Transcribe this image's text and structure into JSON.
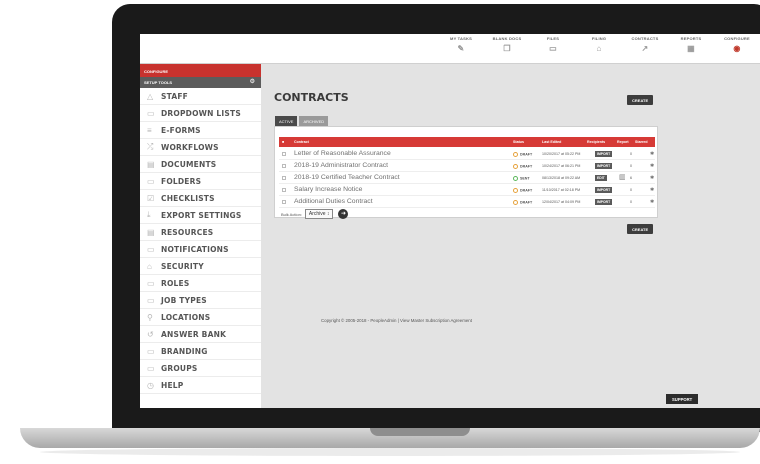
{
  "topnav": [
    {
      "label": "MY TASKS",
      "icon": "✎",
      "name": "my-tasks",
      "active": false
    },
    {
      "label": "BLANK DOCS",
      "icon": "❐",
      "name": "blank-docs",
      "active": false
    },
    {
      "label": "FILES",
      "icon": "▭",
      "name": "files",
      "active": false
    },
    {
      "label": "FILING",
      "icon": "⌂",
      "name": "filing",
      "active": false
    },
    {
      "label": "CONTRACTS",
      "icon": "↗",
      "name": "contracts",
      "active": false
    },
    {
      "label": "REPORTS",
      "icon": "▦",
      "name": "reports",
      "active": false
    },
    {
      "label": "CONFIGURE",
      "icon": "◉",
      "name": "configure",
      "active": true
    }
  ],
  "sidebar": {
    "header": "CONFIGURE",
    "subheader": "SETUP TOOLS",
    "items": [
      {
        "label": "STAFF",
        "icon": "△"
      },
      {
        "label": "DROPDOWN LISTS",
        "icon": "▭"
      },
      {
        "label": "E-FORMS",
        "icon": "≡"
      },
      {
        "label": "WORKFLOWS",
        "icon": "⤮"
      },
      {
        "label": "DOCUMENTS",
        "icon": "▤"
      },
      {
        "label": "FOLDERS",
        "icon": "▭"
      },
      {
        "label": "CHECKLISTS",
        "icon": "☑"
      },
      {
        "label": "EXPORT SETTINGS",
        "icon": "⤓"
      },
      {
        "label": "RESOURCES",
        "icon": "▤"
      },
      {
        "label": "NOTIFICATIONS",
        "icon": "▭"
      },
      {
        "label": "SECURITY",
        "icon": "⌂"
      },
      {
        "label": "ROLES",
        "icon": "▭"
      },
      {
        "label": "JOB TYPES",
        "icon": "▭"
      },
      {
        "label": "LOCATIONS",
        "icon": "⚲"
      },
      {
        "label": "ANSWER BANK",
        "icon": "↺"
      },
      {
        "label": "BRANDING",
        "icon": "▭"
      },
      {
        "label": "GROUPS",
        "icon": "▭"
      },
      {
        "label": "HELP",
        "icon": "◷"
      }
    ]
  },
  "main": {
    "title": "CONTRACTS",
    "create_label": "CREATE",
    "create_bottom_label": "CREATE",
    "tabs": [
      {
        "label": "ACTIVE",
        "active": true
      },
      {
        "label": "ARCHIVED",
        "active": false
      }
    ],
    "table": {
      "columns": [
        "Contract",
        "Status",
        "Last Edited",
        "Recipients",
        "Report",
        "Starred"
      ],
      "rows": [
        {
          "name": "Letter of Reasonable Assurance",
          "status": "DRAFT",
          "edited": "10/20/2017 at 05:22 PM",
          "action": "IMPORT",
          "count": "0",
          "report": false
        },
        {
          "name": "2018-19 Administrator Contract",
          "status": "DRAFT",
          "edited": "10/24/2017 at 06:21 PM",
          "action": "IMPORT",
          "count": "0",
          "report": false
        },
        {
          "name": "2018-19 Certified Teacher Contract",
          "status": "SENT",
          "edited": "08/13/2018 at 09:22 AM",
          "action": "EDIT",
          "count": "6",
          "report": true
        },
        {
          "name": "Salary Increase Notice",
          "status": "DRAFT",
          "edited": "11/10/2017 at 02:18 PM",
          "action": "IMPORT",
          "count": "0",
          "report": false
        },
        {
          "name": "Additional Duties Contract",
          "status": "DRAFT",
          "edited": "12/04/2017 at 04:09 PM",
          "action": "IMPORT",
          "count": "0",
          "report": false
        }
      ]
    },
    "bulk_label": "Bulk Action:",
    "bulk_value": "Archive ↕",
    "copyright": "Copyright © 2005-2018 - PeopleAdmin | View Master Subscription Agreement",
    "support_label": "SUPPORT"
  }
}
